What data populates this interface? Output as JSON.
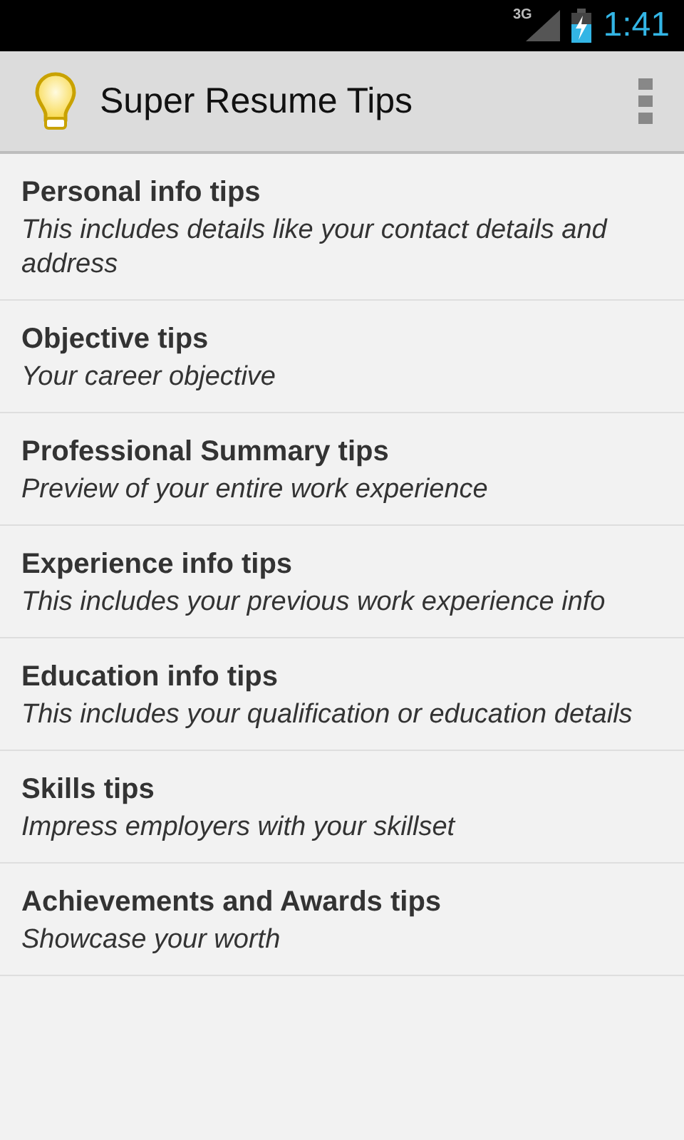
{
  "status_bar": {
    "network": "3G",
    "time": "1:41"
  },
  "action_bar": {
    "title": "Super Resume Tips"
  },
  "items": [
    {
      "title": "Personal info tips",
      "subtitle": "This includes details like your contact details and address"
    },
    {
      "title": "Objective tips",
      "subtitle": "Your career objective"
    },
    {
      "title": "Professional Summary tips",
      "subtitle": "Preview of your entire work experience"
    },
    {
      "title": "Experience info tips",
      "subtitle": "This includes your previous work experience info"
    },
    {
      "title": "Education info tips",
      "subtitle": "This includes your qualification or education details"
    },
    {
      "title": "Skills tips",
      "subtitle": "Impress employers with your skillset"
    },
    {
      "title": "Achievements and Awards tips",
      "subtitle": "Showcase your worth"
    }
  ]
}
